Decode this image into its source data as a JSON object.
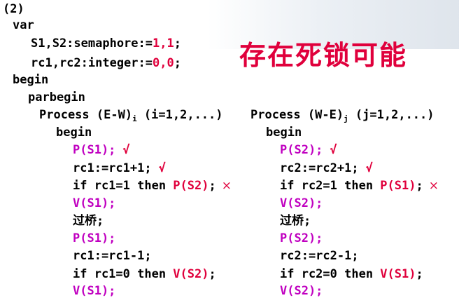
{
  "section_label": "(2)",
  "var_kw": "var",
  "decl1_prefix": "S1,S2:semaphore:=",
  "decl1_vals": "1,1",
  "decl1_suffix": ";",
  "decl2_prefix": "rc1,rc2:integer:=",
  "decl2_vals": "0,0",
  "decl2_suffix": ";",
  "headline": "存在死锁可能",
  "begin_kw": "begin",
  "parbegin_kw": "parbegin",
  "left": {
    "process_title": "Process (E-W)",
    "subscript": "i",
    "params": " (i=1,2,...)",
    "begin": "begin",
    "p_s1": "P(S1);",
    "check": "√",
    "inc_line": "rc1:=rc1+1;",
    "if1_text": "if rc1=1 then ",
    "if1_op": "P(S2)",
    "if1_end": ";",
    "cross": "×",
    "v_s1": "V(S1);",
    "bridge": "过桥;",
    "p_s1b": "P(S1);",
    "dec_line": "rc1:=rc1-1;",
    "if2_text": "if rc1=0 then ",
    "if2_op": "V(S2)",
    "if2_end": ";",
    "v_s1b": "V(S1);"
  },
  "right": {
    "process_title": "Process (W-E)",
    "subscript": "j",
    "params": " (j=1,2,...)",
    "begin": "begin",
    "p_s2": "P(S2);",
    "check": "√",
    "inc_line": "rc2:=rc2+1;",
    "if1_text": "if rc2=1 then ",
    "if1_op": "P(S1)",
    "if1_end": ";",
    "cross": "×",
    "v_s2": "V(S2);",
    "bridge": "过桥;",
    "p_s2b": "P(S2);",
    "dec_line": "rc2:=rc2-1;",
    "if2_text": "if rc2=0 then ",
    "if2_op": "V(S1)",
    "if2_end": ";",
    "v_s2b": "V(S2);"
  },
  "colors": {
    "accent_red": "#e0003c",
    "keyword_purple": "#c000c0"
  }
}
